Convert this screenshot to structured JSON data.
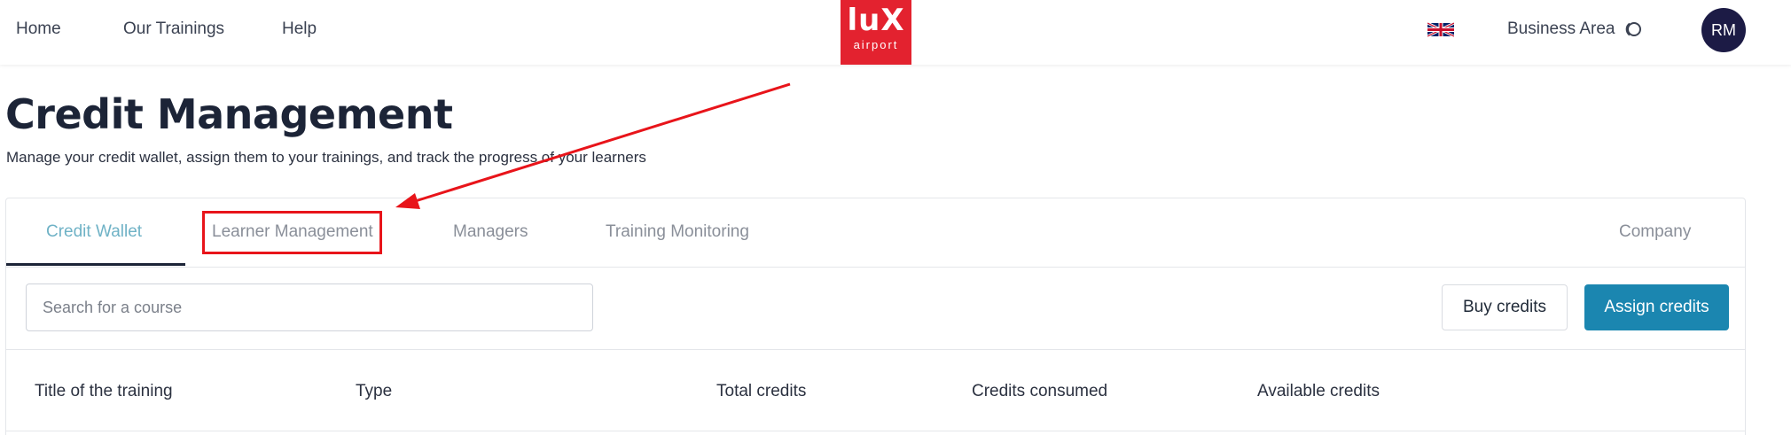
{
  "nav": {
    "links": [
      "Home",
      "Our Trainings",
      "Help"
    ],
    "logo": {
      "top": "luX",
      "bottom": "airport",
      "color": "#e3222f"
    },
    "language_icon": "uk-flag-icon",
    "business_area": "Business Area",
    "business_area_icon": "toggle-ring-icon",
    "avatar_initials": "RM",
    "avatar_color": "#1c1b45"
  },
  "page": {
    "title": "Credit Management",
    "subtitle": "Manage your credit wallet, assign them to your trainings, and track the progress of your learners"
  },
  "tabs": {
    "items": [
      "Credit Wallet",
      "Learner Management",
      "Managers",
      "Training Monitoring",
      "Company"
    ],
    "active": "Credit Wallet",
    "active_color": "#6fb2c6"
  },
  "toolbar": {
    "search_placeholder": "Search for a course",
    "buy_label": "Buy credits",
    "assign_label": "Assign credits",
    "accent_color": "#1b86b0"
  },
  "table": {
    "columns": [
      "Title of the training",
      "Type",
      "Total credits",
      "Credits consumed",
      "Available credits"
    ]
  },
  "annotation": {
    "color": "#e8141a",
    "highlighted_tab": "Learner Management"
  }
}
